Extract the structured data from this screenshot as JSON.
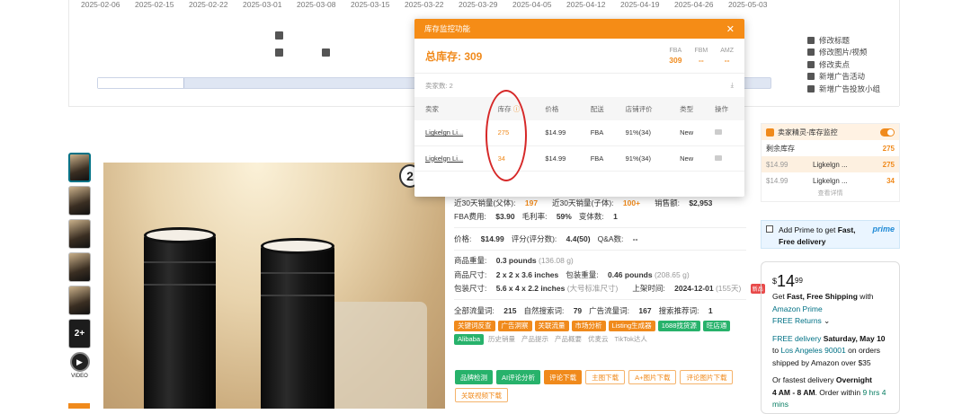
{
  "chart_dates": [
    "2025-02-06",
    "2025-02-15",
    "2025-02-22",
    "2025-03-01",
    "2025-03-08",
    "2025-03-15",
    "2025-03-22",
    "2025-03-29",
    "2025-04-05",
    "2025-04-12",
    "2025-04-19",
    "2025-04-26",
    "2025-05-03"
  ],
  "legend": [
    "修改标题",
    "修改图片/视频",
    "修改卖点",
    "新增广告活动",
    "新增广告投放小组"
  ],
  "popup": {
    "title": "库存监控功能",
    "close": "✕",
    "total_label": "总库存: 309",
    "fba_label": "FBA",
    "fba_value": "309",
    "fbm_label": "FBM",
    "fbm_value": "--",
    "amz_label": "AMZ",
    "amz_value": "--",
    "sellers_count": "卖家数: 2",
    "columns": [
      "卖家",
      "库存",
      "价格",
      "配送",
      "店铺评价",
      "类型",
      "操作"
    ],
    "rows": [
      {
        "seller": "Ligkelgn Li...",
        "inventory": "275",
        "price": "$14.99",
        "fulfill": "FBA",
        "rating": "91%(34)",
        "type": "New"
      },
      {
        "seller": "Ligkelgn Li...",
        "inventory": "34",
        "price": "$14.99",
        "fulfill": "FBA",
        "rating": "91%(34)",
        "type": "New"
      }
    ]
  },
  "info": {
    "sales_parent_label": "近30天销量(父体):",
    "sales_parent": "197",
    "sales_child_label": "近30天销量(子体):",
    "sales_child": "100+",
    "revenue_label": "销售额:",
    "revenue": "$2,953",
    "fba_fee_label": "FBA费用:",
    "fba_fee": "$3.90",
    "margin_label": "毛利率:",
    "margin": "59%",
    "variants_label": "变体数:",
    "variants": "1",
    "price_label": "价格:",
    "price": "$14.99",
    "reviews_label": "评分(评分数):",
    "reviews": "4.4(50)",
    "qa_label": "Q&A数:",
    "qa": "--",
    "weight_label": "商品重量:",
    "weight": "0.3 pounds",
    "weight_g": "(136.08 g)",
    "dims_label": "商品尺寸:",
    "dims": "2 x 2 x 3.6 inches",
    "pkg_weight_label": "包装重量:",
    "pkg_weight": "0.46 pounds",
    "pkg_weight_g": "(208.65 g)",
    "pkg_dims_label": "包装尺寸:",
    "pkg_dims": "5.6 x 4 x 2.2 inches",
    "pkg_std": "(大号标准尺寸)",
    "launch_label": "上架时间:",
    "launch": "2024-12-01",
    "launch_days": "(155天)",
    "new_badge": "新品",
    "traffic_label": "全部流量词:",
    "traffic": "215",
    "organic_label": "自然搜索词:",
    "organic": "79",
    "ad_label": "广告流量词:",
    "ad": "167",
    "rec_label": "搜索推荐词:",
    "rec": "1"
  },
  "tags": [
    "关键词反查",
    "广告洞察",
    "关联流量",
    "市场分析",
    "Listing生成器",
    "1688找货源",
    "旺店通",
    "Alibaba",
    "历史销量",
    "产品提示",
    "产品概要",
    "优麦云",
    "TikTok达人"
  ],
  "buttons": [
    "品牌检测",
    "AI评论分析",
    "评论下载",
    "主图下载",
    "A+图片下载",
    "评论图片下载",
    "关联视频下载"
  ],
  "sidepanel": {
    "title": "卖家精灵-库存监控",
    "remaining_label": "剩余库存",
    "remaining": "275",
    "rows": [
      {
        "price": "$14.99",
        "seller": "Ligkelgn ...",
        "qty": "275"
      },
      {
        "price": "$14.99",
        "seller": "Ligkelgn ...",
        "qty": "34"
      }
    ],
    "more": "查看详情"
  },
  "prime": {
    "text1": "Add Prime to get",
    "text2": "Fast, Free delivery",
    "logo": "prime"
  },
  "buybox": {
    "currency": "$",
    "dollars": "14",
    "cents": "99",
    "line1a": "Get ",
    "line1b": "Fast, Free Shipping",
    "line1c": " with",
    "amazon_prime": "Amazon Prime",
    "free_returns": "FREE Returns",
    "free_delivery": "FREE delivery",
    "delivery_date": "Saturday, May 10",
    "to": "to ",
    "location": "Los Angeles 90001",
    "orders_over": " on orders shipped by Amazon over $35",
    "fastest": "Or fastest delivery ",
    "overnight": "Overnight",
    "time_window": "4 AM - 8 AM",
    "order_within": ". Order within ",
    "countdown": "9 hrs 4 mins"
  },
  "hero_badge": "2",
  "video_label": "VIDEO",
  "plus_label": "2+"
}
